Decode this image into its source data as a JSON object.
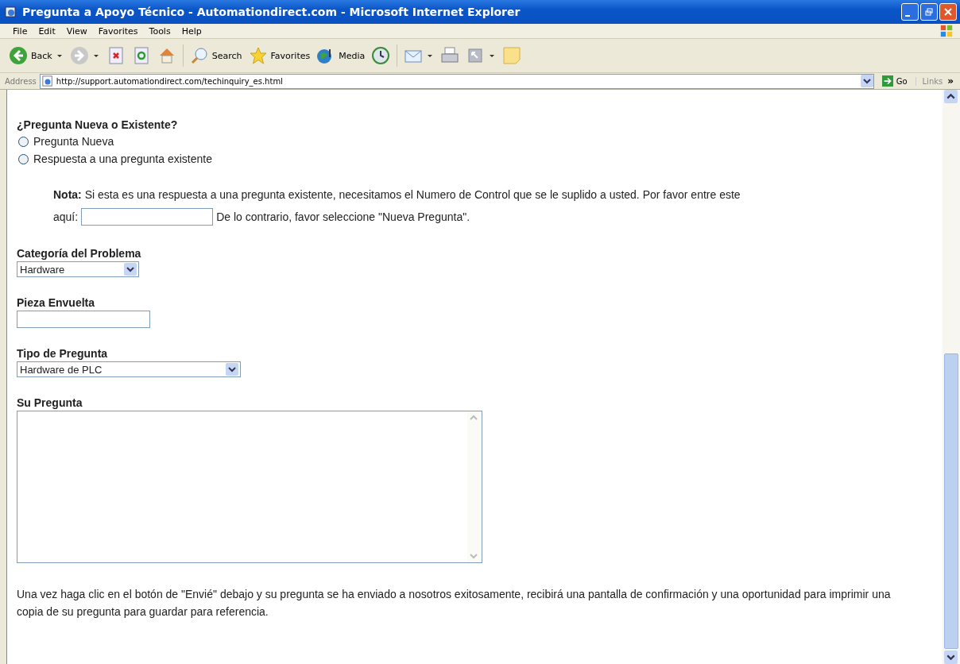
{
  "window": {
    "title": "Pregunta a Apoyo Técnico - Automationdirect.com - Microsoft Internet Explorer"
  },
  "menu": [
    "File",
    "Edit",
    "View",
    "Favorites",
    "Tools",
    "Help"
  ],
  "toolbar": [
    {
      "kind": "back",
      "label": "Back"
    },
    {
      "kind": "forward"
    },
    {
      "kind": "stop"
    },
    {
      "kind": "refresh"
    },
    {
      "kind": "home"
    },
    {
      "kind": "search",
      "label": "Search"
    },
    {
      "kind": "favorites",
      "label": "Favorites"
    },
    {
      "kind": "media",
      "label": "Media"
    },
    {
      "kind": "history"
    },
    {
      "kind": "mail"
    },
    {
      "kind": "print"
    },
    {
      "kind": "edit"
    },
    {
      "kind": "note"
    }
  ],
  "address": {
    "label": "Address",
    "url": "http://support.automationdirect.com/techinquiry_es.html",
    "go": "Go",
    "links": "Links",
    "more": "»"
  },
  "form": {
    "question_type": {
      "heading": "¿Pregunta Nueva o Existente?",
      "options": [
        {
          "label": "Pregunta Nueva",
          "selected": false
        },
        {
          "label": "Respuesta a una pregunta existente",
          "selected": false
        }
      ]
    },
    "note": {
      "text": "**Nota:** Si esta es una respuesta a una pregunta existente, necesitamos el Numero de Control que se le suplido a usted. Por favor entre este",
      "prompt": "aquí:",
      "after": "De lo contrario, favor seleccione \"Nueva Pregunta\"."
    },
    "category": {
      "label": "Categoría del Problema",
      "value": "Hardware"
    },
    "part": {
      "label": "Pieza Envuelta"
    },
    "type": {
      "label": "Tipo de Pregunta",
      "value": "Hardware de PLC"
    },
    "question": {
      "label": "Su Pregunta"
    },
    "footer": "Una vez haga clic en el botón de \"Envié\" debajo y su pregunta se ha enviado a nosotros exitosamente, recibirá una pantalla de confirmación y una oportunidad para imprimir una copia de su pregunta para guardar para referencia."
  }
}
